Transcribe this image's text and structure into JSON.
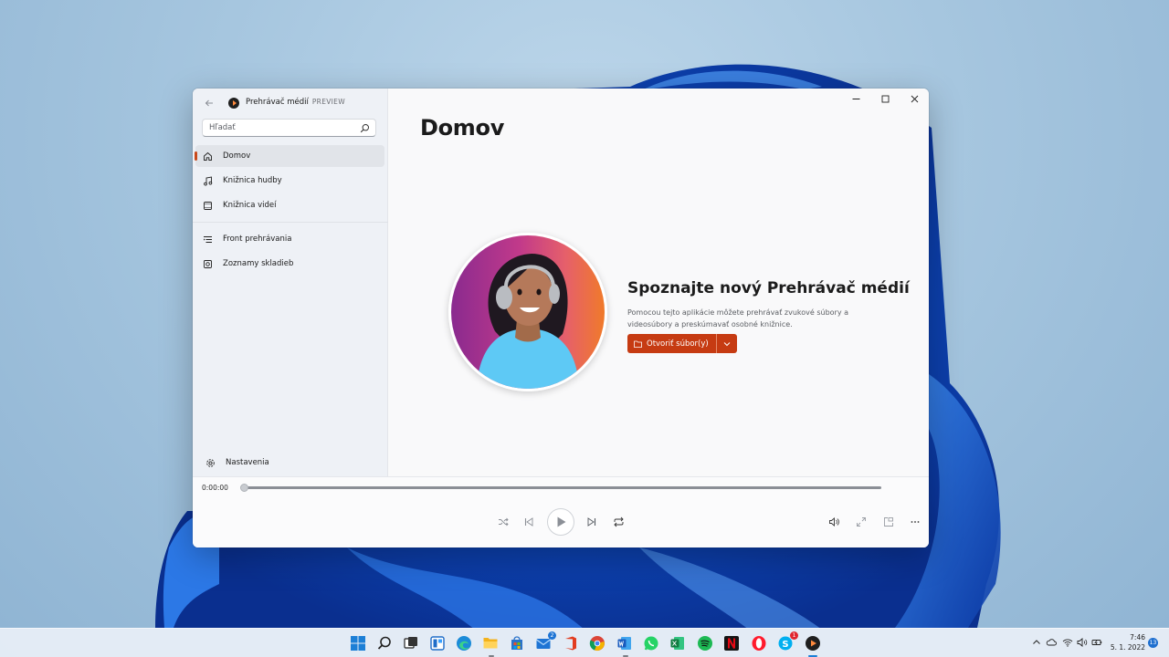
{
  "app": {
    "title": "Prehrávač médií",
    "badge": "PREVIEW"
  },
  "search": {
    "placeholder": "Hľadať"
  },
  "nav": {
    "items": [
      {
        "label": "Domov",
        "icon": "home-icon",
        "active": true
      },
      {
        "label": "Knižnica hudby",
        "icon": "music-note-icon"
      },
      {
        "label": "Knižnica videí",
        "icon": "video-icon"
      }
    ],
    "secondary": [
      {
        "label": "Front prehrávania",
        "icon": "queue-icon"
      },
      {
        "label": "Zoznamy skladieb",
        "icon": "playlist-icon"
      }
    ],
    "settings": {
      "label": "Nastavenia",
      "icon": "gear-icon"
    }
  },
  "main": {
    "page_title": "Domov",
    "hero": {
      "heading": "Spoznajte nový Prehrávač médií",
      "description": "Pomocou tejto aplikácie môžete prehrávať zvukové súbory a videosúbory a preskúmavať osobné knižnice.",
      "open_button": "Otvoriť súbor(y)"
    }
  },
  "player": {
    "current_time": "0:00:00",
    "progress": 0
  },
  "taskbar": {
    "apps": [
      "start",
      "search",
      "task-view",
      "widgets",
      "edge",
      "file-explorer",
      "store",
      "mail",
      "office",
      "chrome",
      "word",
      "whatsapp",
      "excel",
      "spotify",
      "netflix",
      "opera",
      "skype",
      "media-player"
    ],
    "mail_badge": "2",
    "skype_badge": "1",
    "time": "7:46",
    "date": "5. 1. 2022",
    "notifications": "13"
  },
  "colors": {
    "accent": "#c63b12",
    "window_bg": "#f9f9fa",
    "sidebar_bg": "#eef1f6"
  }
}
